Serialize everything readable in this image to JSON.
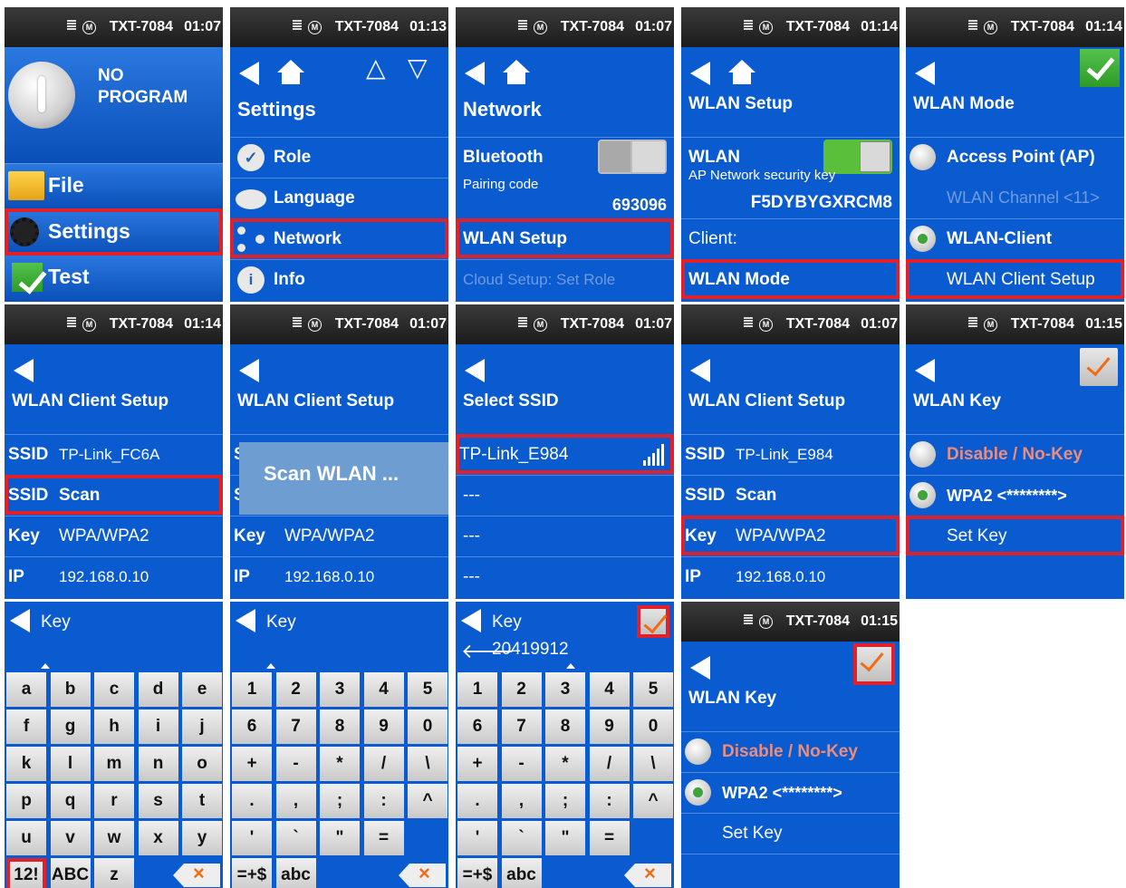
{
  "device": {
    "name": "TXT-7084",
    "mode_icon": "M"
  },
  "p1": {
    "time": "01:07",
    "program": [
      "NO",
      "PROGRAM"
    ],
    "menu": [
      "File",
      "Settings",
      "Test"
    ]
  },
  "p2": {
    "time": "01:13",
    "title": "Settings",
    "items": [
      "Role",
      "Language",
      "Network",
      "Info"
    ]
  },
  "p3": {
    "time": "01:07",
    "title": "Network",
    "bluetooth": "Bluetooth",
    "pairing_label": "Pairing code",
    "pairing_code": "693096",
    "wlan_setup": "WLAN Setup",
    "cloud": "Cloud Setup: Set Role"
  },
  "p4": {
    "time": "01:14",
    "title": "WLAN Setup",
    "wlan": "WLAN",
    "ap_key_label": "AP Network security key",
    "ap_key": "F5DYBYGXRCM8",
    "client": "Client:",
    "mode": "WLAN Mode"
  },
  "p5": {
    "time": "01:14",
    "title": "WLAN Mode",
    "ap": "Access Point (AP)",
    "channel": "WLAN Channel <11>",
    "client": "WLAN-Client",
    "client_setup": "WLAN Client Setup"
  },
  "p6": {
    "time": "01:14",
    "title": "WLAN Client Setup",
    "ssid_label": "SSID",
    "ssid": "TP-Link_FC6A",
    "scan": "Scan",
    "key_label": "Key",
    "key": "WPA/WPA2",
    "ip_label": "IP",
    "ip": "192.168.0.10"
  },
  "p7": {
    "time": "01:07",
    "title": "WLAN Client Setup",
    "popup": "Scan WLAN ...",
    "key_label": "Key",
    "key": "WPA/WPA2",
    "ip_label": "IP",
    "ip": "192.168.0.10"
  },
  "p8": {
    "time": "01:07",
    "title": "Select SSID",
    "ssids": [
      "TP-Link_E984",
      "---",
      "---",
      "---"
    ]
  },
  "p9": {
    "time": "01:07",
    "title": "WLAN Client Setup",
    "ssid_label": "SSID",
    "ssid": "TP-Link_E984",
    "scan": "Scan",
    "key_label": "Key",
    "key": "WPA/WPA2",
    "ip_label": "IP",
    "ip": "192.168.0.10"
  },
  "p10": {
    "time": "01:15",
    "title": "WLAN Key",
    "disable": "Disable / No-Key",
    "wpa2": "WPA2 <********>",
    "set_key": "Set Key"
  },
  "k1": {
    "title": "Key",
    "rows": [
      [
        "a",
        "b",
        "c",
        "d",
        "e"
      ],
      [
        "f",
        "g",
        "h",
        "i",
        "j"
      ],
      [
        "k",
        "l",
        "m",
        "n",
        "o"
      ],
      [
        "p",
        "q",
        "r",
        "s",
        "t"
      ],
      [
        "u",
        "v",
        "w",
        "x",
        "y"
      ]
    ],
    "bottom": [
      "12!",
      "ABC",
      "z"
    ]
  },
  "k2": {
    "title": "Key",
    "rows": [
      [
        "1",
        "2",
        "3",
        "4",
        "5"
      ],
      [
        "6",
        "7",
        "8",
        "9",
        "0"
      ],
      [
        "+",
        "-",
        "*",
        "/",
        "\\"
      ],
      [
        ".",
        ",",
        ";",
        ":",
        "^"
      ],
      [
        "'",
        "`",
        "\"",
        "="
      ]
    ],
    "bottom": [
      "=+$",
      "abc"
    ]
  },
  "k3": {
    "title": "Key",
    "value": "20419912",
    "rows": [
      [
        "1",
        "2",
        "3",
        "4",
        "5"
      ],
      [
        "6",
        "7",
        "8",
        "9",
        "0"
      ],
      [
        "+",
        "-",
        "*",
        "/",
        "\\"
      ],
      [
        ".",
        ",",
        ";",
        ":",
        "^"
      ],
      [
        "'",
        "`",
        "\"",
        "="
      ]
    ],
    "bottom": [
      "=+$",
      "abc"
    ]
  },
  "p14": {
    "time": "01:15",
    "title": "WLAN Key",
    "disable": "Disable / No-Key",
    "wpa2": "WPA2 <********>",
    "set_key": "Set Key"
  },
  "colors": {
    "bg": "#0a5bd0",
    "highlight": "#e0202a",
    "accent_orange": "#f26b12",
    "disabled_salmon": "#ee8c7a"
  },
  "icons": {
    "back": "back-arrow-icon",
    "home": "home-icon",
    "check": "check-icon",
    "backspace": "backspace-icon"
  }
}
